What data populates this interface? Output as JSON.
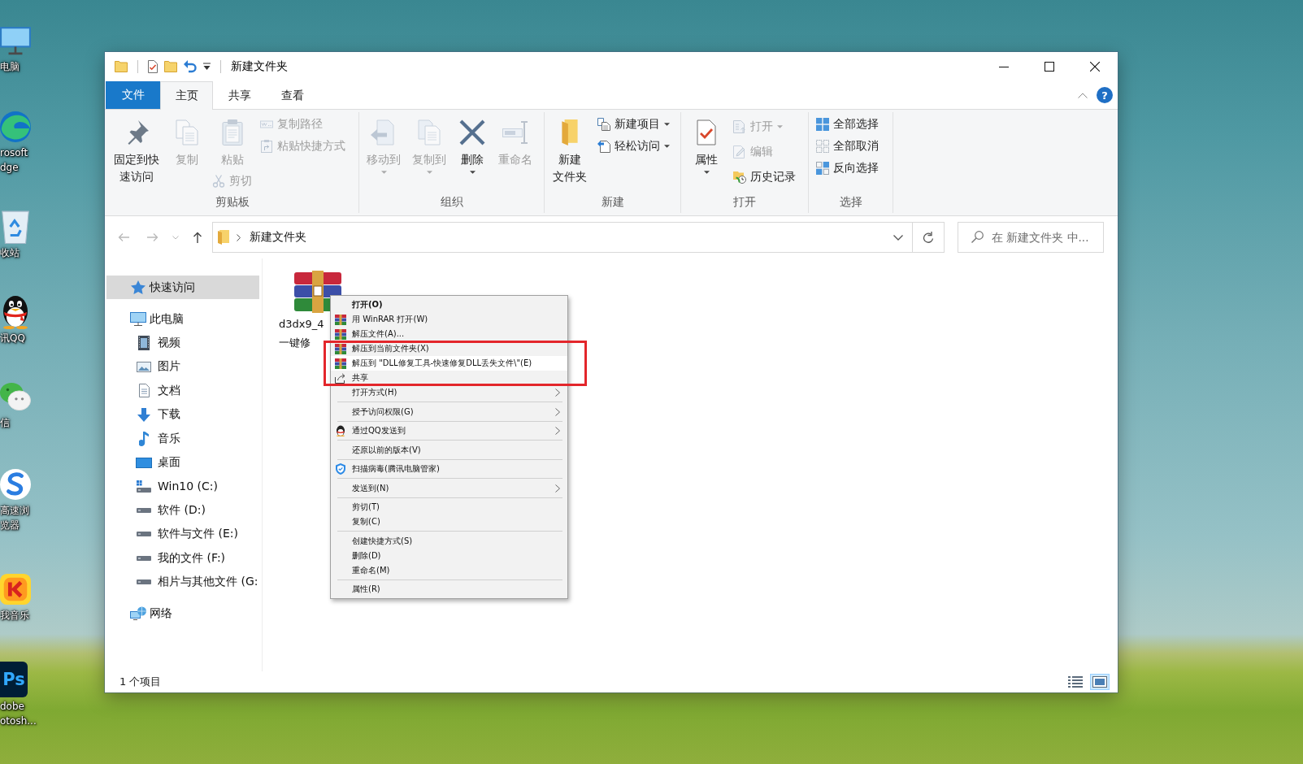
{
  "desktop": {
    "icons": [
      {
        "label_lines": [
          "电脑"
        ]
      },
      {
        "label_lines": [
          "rosoft",
          "dge"
        ]
      },
      {
        "label_lines": [
          "收站"
        ]
      },
      {
        "label_lines": [
          "讯QQ"
        ]
      },
      {
        "label_lines": [
          "信"
        ]
      },
      {
        "label_lines": [
          "高速浏",
          "览器"
        ]
      },
      {
        "label_lines": [
          "我音乐"
        ]
      },
      {
        "label_lines": [
          "dobe",
          "otosh..."
        ],
        "logo_text": "Ps"
      }
    ]
  },
  "window": {
    "title": "新建文件夹",
    "help_label": "?"
  },
  "ribbon": {
    "tabs": [
      {
        "label": "文件",
        "kind": "file",
        "selected": false
      },
      {
        "label": "主页",
        "kind": "tab",
        "selected": true
      },
      {
        "label": "共享",
        "kind": "tab",
        "selected": false
      },
      {
        "label": "查看",
        "kind": "tab",
        "selected": false
      }
    ],
    "groups": [
      {
        "label": "剪贴板",
        "columns": [
          [
            {
              "kind": "large",
              "lines": [
                "固定到快",
                "速访问"
              ],
              "disabled": false,
              "dropdown": false
            }
          ],
          [
            {
              "kind": "large",
              "lines": [
                "复制"
              ],
              "disabled": true,
              "dropdown": false
            }
          ],
          [
            {
              "kind": "large",
              "lines": [
                "粘贴"
              ],
              "disabled": true,
              "dropdown": false
            },
            {
              "kind": "small",
              "lines": [
                "剪切"
              ],
              "disabled": true,
              "dropdown": false
            }
          ],
          [
            {
              "kind": "small",
              "lines": [
                "复制路径"
              ],
              "disabled": true,
              "dropdown": false
            },
            {
              "kind": "small",
              "lines": [
                "粘贴快捷方式"
              ],
              "disabled": true,
              "dropdown": false
            }
          ]
        ]
      },
      {
        "label": "组织",
        "columns": [
          [
            {
              "kind": "large",
              "lines": [
                "移动到"
              ],
              "disabled": true,
              "dropdown": true
            }
          ],
          [
            {
              "kind": "large",
              "lines": [
                "复制到"
              ],
              "disabled": true,
              "dropdown": true
            }
          ],
          [
            {
              "kind": "large",
              "lines": [
                "删除"
              ],
              "disabled": false,
              "dropdown": true
            }
          ],
          [
            {
              "kind": "large",
              "lines": [
                "重命名"
              ],
              "disabled": true,
              "dropdown": false
            }
          ]
        ]
      },
      {
        "label": "新建",
        "columns": [
          [
            {
              "kind": "large",
              "lines": [
                "新建",
                "文件夹"
              ],
              "disabled": false,
              "dropdown": false
            }
          ],
          [
            {
              "kind": "small",
              "lines": [
                "新建项目"
              ],
              "disabled": false,
              "dropdown": true
            },
            {
              "kind": "small",
              "lines": [
                "轻松访问"
              ],
              "disabled": false,
              "dropdown": true
            }
          ]
        ]
      },
      {
        "label": "打开",
        "columns": [
          [
            {
              "kind": "large",
              "lines": [
                "属性"
              ],
              "disabled": false,
              "dropdown": true
            }
          ],
          [
            {
              "kind": "small",
              "lines": [
                "打开"
              ],
              "disabled": true,
              "dropdown": true
            },
            {
              "kind": "small",
              "lines": [
                "编辑"
              ],
              "disabled": true,
              "dropdown": false
            },
            {
              "kind": "small",
              "lines": [
                "历史记录"
              ],
              "disabled": false,
              "dropdown": false
            }
          ]
        ]
      },
      {
        "label": "选择",
        "columns": [
          [
            {
              "kind": "small",
              "lines": [
                "全部选择"
              ],
              "disabled": false,
              "dropdown": false
            },
            {
              "kind": "small",
              "lines": [
                "全部取消"
              ],
              "disabled": false,
              "dropdown": false
            },
            {
              "kind": "small",
              "lines": [
                "反向选择"
              ],
              "disabled": false,
              "dropdown": false
            }
          ]
        ]
      }
    ]
  },
  "address_bar": {
    "crumbs": [
      "新建文件夹"
    ]
  },
  "search": {
    "placeholder": "在 新建文件夹 中..."
  },
  "navigation": {
    "items": [
      {
        "label": "快速访问",
        "selected": true
      },
      {
        "label": "此电脑",
        "selected": false,
        "children": [
          {
            "label": "视频",
            "selected": false
          },
          {
            "label": "图片",
            "selected": false
          },
          {
            "label": "文档",
            "selected": false
          },
          {
            "label": "下载",
            "selected": false
          },
          {
            "label": "音乐",
            "selected": false
          },
          {
            "label": "桌面",
            "selected": false
          },
          {
            "label": "Win10 (C:)",
            "selected": false
          },
          {
            "label": "软件 (D:)",
            "selected": false
          },
          {
            "label": "软件与文件 (E:)",
            "selected": false
          },
          {
            "label": "我的文件 (F:)",
            "selected": false
          },
          {
            "label": "相片与其他文件 (G:",
            "selected": false
          }
        ]
      },
      {
        "label": "网络",
        "selected": false
      }
    ]
  },
  "files": [
    {
      "name_lines": [
        "d3dx9_4",
        "一键修"
      ]
    }
  ],
  "context_menu": {
    "sections": [
      {
        "items": [
          {
            "label": "打开(O)",
            "default": true,
            "submenu": false,
            "selected": false,
            "marked": false
          },
          {
            "label": "用 WinRAR 打开(W)",
            "default": false,
            "submenu": false,
            "selected": false,
            "marked": false
          },
          {
            "label": "解压文件(A)...",
            "default": false,
            "submenu": false,
            "selected": false,
            "marked": false
          },
          {
            "label": "解压到当前文件夹(X)",
            "default": false,
            "submenu": false,
            "selected": false,
            "marked": true
          },
          {
            "label": "解压到 \"DLL修复工具-快速修复DLL丢失文件\\\"(E)",
            "default": false,
            "submenu": false,
            "selected": true,
            "marked": true
          },
          {
            "label": "共享",
            "default": false,
            "submenu": false,
            "selected": false,
            "marked": true
          },
          {
            "label": "打开方式(H)",
            "default": false,
            "submenu": true,
            "selected": false,
            "marked": false
          }
        ]
      },
      {
        "items": [
          {
            "label": "授予访问权限(G)",
            "default": false,
            "submenu": true,
            "selected": false,
            "marked": false
          }
        ]
      },
      {
        "items": [
          {
            "label": "通过QQ发送到",
            "default": false,
            "submenu": true,
            "selected": false,
            "marked": false
          }
        ]
      },
      {
        "items": [
          {
            "label": "还原以前的版本(V)",
            "default": false,
            "submenu": false,
            "selected": false,
            "marked": false
          }
        ]
      },
      {
        "items": [
          {
            "label": "扫描病毒(腾讯电脑管家)",
            "default": false,
            "submenu": false,
            "selected": false,
            "marked": false
          }
        ]
      },
      {
        "items": [
          {
            "label": "发送到(N)",
            "default": false,
            "submenu": true,
            "selected": false,
            "marked": false
          }
        ]
      },
      {
        "items": [
          {
            "label": "剪切(T)",
            "default": false,
            "submenu": false,
            "selected": false,
            "marked": false
          },
          {
            "label": "复制(C)",
            "default": false,
            "submenu": false,
            "selected": false,
            "marked": false
          }
        ]
      },
      {
        "items": [
          {
            "label": "创建快捷方式(S)",
            "default": false,
            "submenu": false,
            "selected": false,
            "marked": false
          },
          {
            "label": "删除(D)",
            "default": false,
            "submenu": false,
            "selected": false,
            "marked": false
          },
          {
            "label": "重命名(M)",
            "default": false,
            "submenu": false,
            "selected": false,
            "marked": false
          }
        ]
      },
      {
        "items": [
          {
            "label": "属性(R)",
            "default": false,
            "submenu": false,
            "selected": false,
            "marked": false
          }
        ]
      }
    ]
  },
  "status_bar": {
    "item_count": "1 个项目",
    "views": [
      {
        "selected": false
      },
      {
        "selected": true
      }
    ]
  }
}
